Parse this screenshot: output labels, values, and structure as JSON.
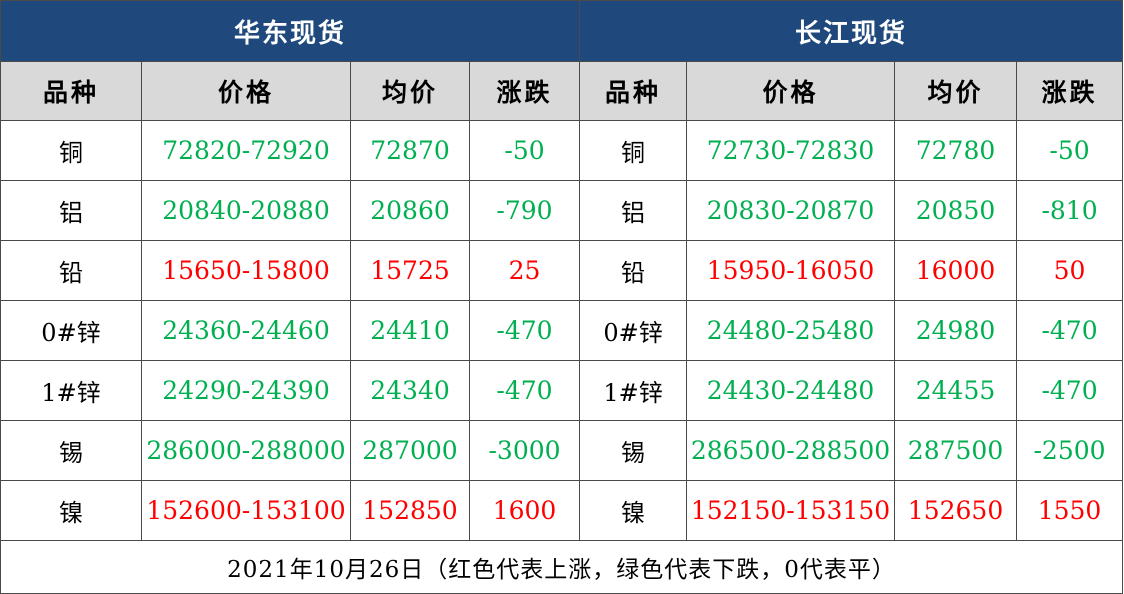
{
  "colors": {
    "header_bg": "#1f497d",
    "subheader_bg": "#d9d9d9",
    "up": "#ff0000",
    "down": "#00b050"
  },
  "titles": {
    "east": "华东现货",
    "yangtze": "长江现货"
  },
  "headers": [
    "品种",
    "价格",
    "均价",
    "涨跌",
    "品种",
    "价格",
    "均价",
    "涨跌"
  ],
  "rows": [
    {
      "trend": "down",
      "cells": [
        "铜",
        "72820-72920",
        "72870",
        "-50",
        "铜",
        "72730-72830",
        "72780",
        "-50"
      ]
    },
    {
      "trend": "down",
      "cells": [
        "铝",
        "20840-20880",
        "20860",
        "-790",
        "铝",
        "20830-20870",
        "20850",
        "-810"
      ]
    },
    {
      "trend": "up",
      "cells": [
        "铅",
        "15650-15800",
        "15725",
        "25",
        "铅",
        "15950-16050",
        "16000",
        "50"
      ]
    },
    {
      "trend": "down",
      "cells": [
        "0#锌",
        "24360-24460",
        "24410",
        "-470",
        "0#锌",
        "24480-25480",
        "24980",
        "-470"
      ]
    },
    {
      "trend": "down",
      "cells": [
        "1#锌",
        "24290-24390",
        "24340",
        "-470",
        "1#锌",
        "24430-24480",
        "24455",
        "-470"
      ]
    },
    {
      "trend": "down",
      "cells": [
        "锡",
        "286000-288000",
        "287000",
        "-3000",
        "锡",
        "286500-288500",
        "287500",
        "-2500"
      ]
    },
    {
      "trend": "up",
      "cells": [
        "镍",
        "152600-153100",
        "152850",
        "1600",
        "镍",
        "152150-153150",
        "152650",
        "1550"
      ]
    }
  ],
  "footer": "2021年10月26日（红色代表上涨，绿色代表下跌，0代表平）"
}
